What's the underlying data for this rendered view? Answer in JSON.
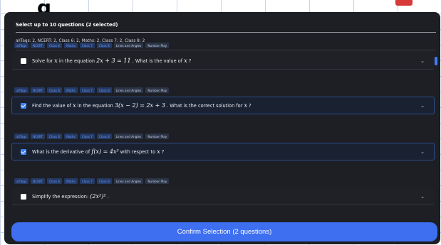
{
  "background": {
    "peek_text": "g"
  },
  "modal": {
    "header": "Select up to 10 questions (2 selected)",
    "tag_summary": "allTags: 2, NCERT: 2, Class 6: 2, Maths: 2, Class 7: 2, Class 8: 2",
    "confirm_label": "Confirm Selection (2 questions)"
  },
  "tags": [
    "allTags",
    "NCERT",
    "Class 6",
    "Maths",
    "Class 7",
    "Class 8",
    "Lines and Angles",
    "Number Play"
  ],
  "questions": [
    {
      "checked": false,
      "text_before": "Solve for",
      "var1": "x",
      "text_mid": "in the equation",
      "equation": "2x + 3 = 11",
      "text_after": ". What is the value of",
      "var2": "x",
      "text_end": "?"
    },
    {
      "checked": true,
      "text_before": "Find the value of",
      "var1": "x",
      "text_mid": "in the equation",
      "equation": "3(x − 2) = 2x + 3",
      "text_after": ". What is the correct solution for",
      "var2": "x",
      "text_end": "?"
    },
    {
      "checked": true,
      "text_before": "What is the derivative of",
      "var1": "f(x) = 4x³",
      "text_mid": "with respect to",
      "equation": "x",
      "text_after": "?",
      "var2": "",
      "text_end": ""
    },
    {
      "checked": false,
      "text_before": "Simplify the expression:",
      "var1": "(2x²)²",
      "text_mid": ".",
      "equation": "",
      "text_after": "",
      "var2": "",
      "text_end": ""
    }
  ],
  "colors": {
    "modal_bg": "#1d1f24",
    "accent": "#3d6ff0",
    "selected_border": "#2d4b8a",
    "tag_bg": "#243a66",
    "tag_text": "#6f97ea"
  },
  "icons": {
    "chevron": "chevron-down-icon",
    "check": "checkmark-icon"
  }
}
